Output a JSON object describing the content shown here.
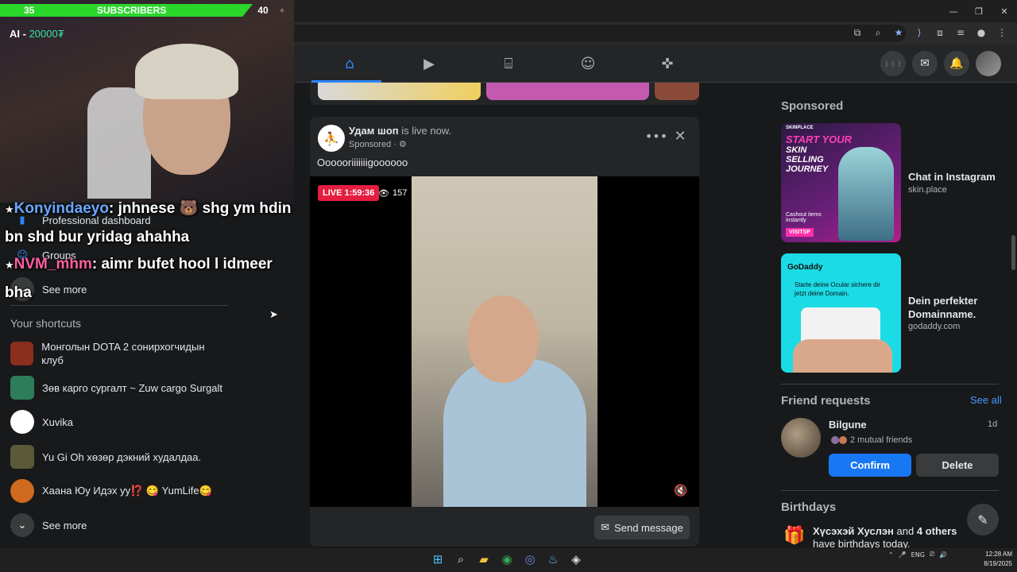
{
  "window": {
    "minimize_glyph": "—",
    "restore_glyph": "❐",
    "close_glyph": "✕"
  },
  "toolbar_icons": [
    "⧉",
    "⌕",
    "★",
    "⟩",
    "⧈",
    "≡",
    "●",
    "⋮"
  ],
  "facebook_nav": {
    "tabs": [
      {
        "name": "home",
        "glyph": "⌂"
      },
      {
        "name": "video",
        "glyph": "▶"
      },
      {
        "name": "marketplace",
        "glyph": "⌸"
      },
      {
        "name": "groups",
        "glyph": "☺"
      },
      {
        "name": "gaming",
        "glyph": "✜"
      }
    ],
    "menu_glyph": "⋮⋮⋮",
    "messenger_glyph": "✉",
    "notifications_glyph": "🔔"
  },
  "stream_overlay": {
    "sub_start": "35",
    "sub_label": "SUBSCRIBERS",
    "sub_goal": "40",
    "goal_name": "AI - ",
    "goal_amount": "20000₮",
    "plus": "+"
  },
  "chat": {
    "messages": [
      {
        "user": "Konyindaeyo",
        "text": ": jnhnese 🐻 shg ym hdin bn shd bur yridag ahahha"
      },
      {
        "user": "NVM_mhm",
        "text": ": aimr bufet hool l idmeer bha"
      }
    ]
  },
  "sidebar": {
    "items": [
      {
        "label": "Professional dashboard",
        "glyph": "▮"
      },
      {
        "label": "Groups",
        "glyph": "☺"
      },
      {
        "label": "See more",
        "glyph": "⌄"
      }
    ],
    "shortcuts_heading": "Your shortcuts",
    "shortcuts": [
      {
        "label": "Монголын DOTA 2 сонирхогчидын клуб",
        "color": "#8a2e1e"
      },
      {
        "label": "Зөв карго сургалт ~ Zuw cargo Surgalt",
        "color": "#2e7d5a"
      },
      {
        "label": "Xuvika",
        "color": "#ffffff"
      },
      {
        "label": "Yu Gi Oh хөзөр дэкний худалдаа.",
        "color": "#5a5a3a"
      },
      {
        "label": "Хаана Юу Идэх уу⁉️ 😋 YumLife😋",
        "color": "#d06a1e"
      }
    ],
    "see_more": "See more",
    "see_more_glyph": "⌄"
  },
  "post": {
    "page_name": "Удам шоп",
    "status": " is live now.",
    "sponsored": "Sponsored · ⚙",
    "more_glyph": "•••",
    "close_glyph": "✕",
    "text": "Oooooriiiiiiigoooooo",
    "live_label": "LIVE 1:59:36",
    "viewers": "157",
    "viewers_glyph": "👁",
    "mute_glyph": "🔇",
    "send_message": "Send message",
    "send_glyph": "✉",
    "logo_glyph": "⛹"
  },
  "right_column": {
    "sponsored_heading": "Sponsored",
    "ads": [
      {
        "title": "Chat in Instagram",
        "site": "skin.place",
        "brand": "SKINPLACE",
        "headline": "START YOUR",
        "subheadline": "SKIN SELLING JOURNEY",
        "cashout": "Cashout items instantly",
        "visit": "VISITSP"
      },
      {
        "title": "Dein perfekter Domainname.",
        "site": "godaddy.com",
        "brand": "GoDaddy",
        "copy": "Starte deine Ocular sichere dir jetzt deine Domain."
      }
    ],
    "friend_requests_heading": "Friend requests",
    "see_all": "See all",
    "request": {
      "name": "Bilgune",
      "time": "1d",
      "mutual": "2 mutual friends",
      "confirm": "Confirm",
      "delete": "Delete"
    },
    "birthdays_heading": "Birthdays",
    "birthday_icon": "🎁",
    "birthday_name": "Хүсэхэй Хуслэн",
    "birthday_rest_1": " and ",
    "birthday_others": "4 others",
    "birthday_rest_2": " have birthdays today.",
    "compose_glyph": "✎"
  },
  "taskbar": {
    "apps": [
      "⊞",
      "⌕",
      "▰",
      "◉",
      "◎",
      "♨",
      "◈"
    ],
    "tray": [
      "⌃",
      "🎤",
      "ENG",
      "⎚",
      "🔊"
    ],
    "time": "12:28 AM",
    "date": "8/19/2025"
  },
  "cursor_glyph": "➤"
}
